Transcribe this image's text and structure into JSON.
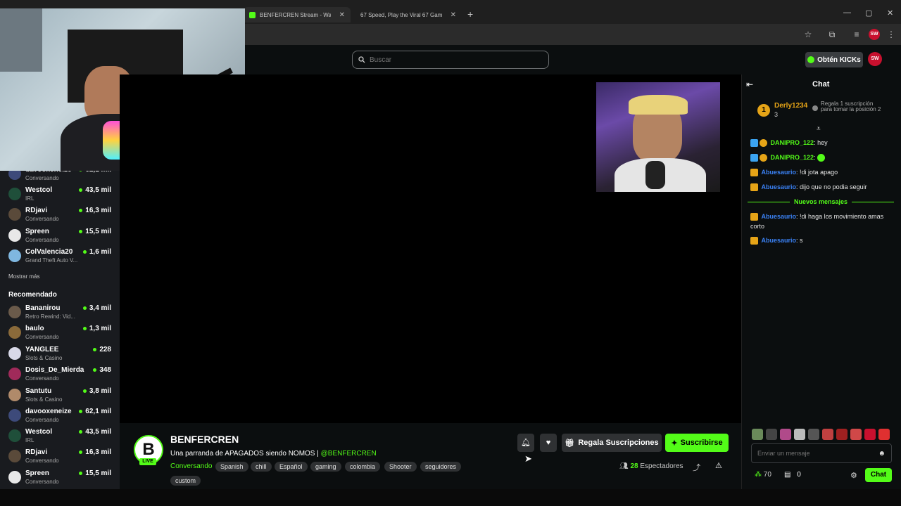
{
  "browser": {
    "tabs": [
      {
        "label": "BENFERCREN Stream - Watch Li"
      },
      {
        "label": "67 Speed, Play the Viral 67 Gam"
      }
    ]
  },
  "header": {
    "search_placeholder": "Buscar",
    "kicks_label": "Obtén KICKs",
    "user_initials": "SW"
  },
  "sidebar": {
    "following": [
      {
        "name": "davooxeneize",
        "category": "Conversando",
        "viewers": "62,1 mil"
      },
      {
        "name": "Westcol",
        "category": "IRL",
        "viewers": "43,5 mil"
      },
      {
        "name": "RDjavi",
        "category": "Conversando",
        "viewers": "16,3 mil"
      },
      {
        "name": "Spreen",
        "category": "Conversando",
        "viewers": "15,5 mil"
      },
      {
        "name": "ColValencia20",
        "category": "Grand Theft Auto V...",
        "viewers": "1,6 mil"
      }
    ],
    "show_more": "Mostrar más",
    "recommended_title": "Recomendado",
    "recommended": [
      {
        "name": "Bananirou",
        "category": "Retro Rewind: Vid...",
        "viewers": "3,4 mil"
      },
      {
        "name": "baulo",
        "category": "Conversando",
        "viewers": "1,3 mil"
      },
      {
        "name": "YANGLEE",
        "category": "Slots & Casino",
        "viewers": "228"
      },
      {
        "name": "Dosis_De_Mierda",
        "category": "Conversando",
        "viewers": "348"
      },
      {
        "name": "Santutu",
        "category": "Slots & Casino",
        "viewers": "3,8 mil"
      },
      {
        "name": "davooxeneize",
        "category": "Conversando",
        "viewers": "62,1 mil"
      },
      {
        "name": "Westcol",
        "category": "IRL",
        "viewers": "43,5 mil"
      },
      {
        "name": "RDjavi",
        "category": "Conversando",
        "viewers": "16,3 mil"
      },
      {
        "name": "Spreen",
        "category": "Conversando",
        "viewers": "15,5 mil"
      }
    ]
  },
  "stream": {
    "channel": "BENFERCREN",
    "live": "LIVE",
    "title": "Una parranda de APAGADOS siendo NOMOS |",
    "mention": "@BENFERCREN",
    "category": "Conversando",
    "tags": [
      "Spanish",
      "chill",
      "Español",
      "gaming",
      "colombia",
      "Shooter",
      "seguidores",
      "custom"
    ],
    "gift_label": "Regala Suscripciones",
    "subscribe_label": "Suscribirse",
    "viewers_count": "28",
    "viewers_label": "Espectadores"
  },
  "chat": {
    "title": "Chat",
    "top_gifter": {
      "name": "Derly1234",
      "rank": "1",
      "count": "3"
    },
    "gift_prompt": "Regala 1 suscripción para tomar la posición 2",
    "messages": [
      {
        "user": "DANIPRO_122",
        "text": "hey"
      },
      {
        "user": "DANIPRO_122",
        "text": ""
      },
      {
        "user": "Abuesaurio",
        "text": "!di jota apago"
      },
      {
        "user": "Abuesaurio",
        "text": "dijo que no podia seguir"
      },
      {
        "user": "Abuesaurio",
        "text": "!di haga los movimiento amas corto"
      },
      {
        "user": "Abuesaurio",
        "text": "s"
      }
    ],
    "new_messages": "Nuevos mensajes",
    "input_placeholder": "Enviar un mensaje",
    "points": "70",
    "chests": "0",
    "send_label": "Chat"
  }
}
